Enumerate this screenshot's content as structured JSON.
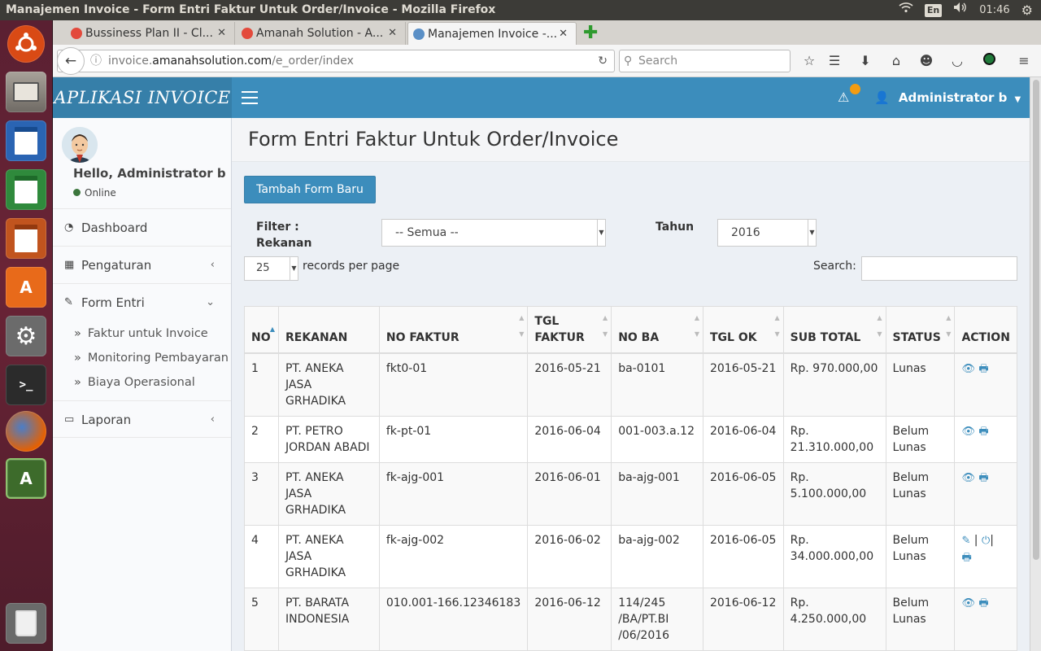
{
  "system": {
    "window_title": "Manajemen Invoice - Form Entri Faktur Untuk Order/Invoice - Mozilla Firefox",
    "lang": "En",
    "time": "01:46"
  },
  "browser": {
    "tabs": [
      {
        "label": "Bussiness Plan II - Cl..."
      },
      {
        "label": "Amanah Solution - A..."
      },
      {
        "label": "Manajemen Invoice -..."
      }
    ],
    "url_prefix": "invoice.",
    "url_domain": "amanahsolution.com",
    "url_path": "/e_order/index",
    "search_placeholder": "Search"
  },
  "app": {
    "logo": "APLIKASI INVOICE",
    "user": "Administrator b",
    "hello": "Hello, Administrator b",
    "status": "Online",
    "menu": {
      "dashboard": "Dashboard",
      "pengaturan": "Pengaturan",
      "form_entri": "Form Entri",
      "sub": [
        "Faktur untuk Invoice",
        "Monitoring Pembayaran",
        "Biaya Operasional"
      ],
      "laporan": "Laporan"
    }
  },
  "content": {
    "title": "Form Entri Faktur Untuk Order/Invoice",
    "add_button": "Tambah Form Baru",
    "filter_label_1": "Filter :",
    "filter_label_2": "Rekanan",
    "filter_value": "-- Semua --",
    "year_label": "Tahun",
    "year_value": "2016",
    "page_size": "25",
    "records_label": "records per page",
    "search_label": "Search:"
  },
  "table": {
    "headers": [
      "NO",
      "REKANAN",
      "NO FAKTUR",
      "TGL FAKTUR",
      "NO BA",
      "TGL OK",
      "SUB TOTAL",
      "STATUS",
      "ACTION"
    ],
    "rows": [
      {
        "no": "1",
        "rekanan": "PT. ANEKA JASA GRHADIKA",
        "faktur": "fkt0-01",
        "tgl_faktur": "2016-05-21",
        "no_ba": "ba-0101",
        "tgl_ok": "2016-05-21",
        "subtotal": "Rp. 970.000,00",
        "status": "Lunas"
      },
      {
        "no": "2",
        "rekanan": "PT. PETRO JORDAN ABADI",
        "faktur": "fk-pt-01",
        "tgl_faktur": "2016-06-04",
        "no_ba": "001-003.a.12",
        "tgl_ok": "2016-06-04",
        "subtotal": "Rp. 21.310.000,00",
        "status": "Belum Lunas"
      },
      {
        "no": "3",
        "rekanan": "PT. ANEKA JASA GRHADIKA",
        "faktur": "fk-ajg-001",
        "tgl_faktur": "2016-06-01",
        "no_ba": "ba-ajg-001",
        "tgl_ok": "2016-06-05",
        "subtotal": "Rp. 5.100.000,00",
        "status": "Belum Lunas"
      },
      {
        "no": "4",
        "rekanan": "PT. ANEKA JASA GRHADIKA",
        "faktur": "fk-ajg-002",
        "tgl_faktur": "2016-06-02",
        "no_ba": "ba-ajg-002",
        "tgl_ok": "2016-06-05",
        "subtotal": "Rp. 34.000.000,00",
        "status": "Belum Lunas"
      },
      {
        "no": "5",
        "rekanan": "PT. BARATA INDONESIA",
        "faktur": "010.001-166.12346183",
        "tgl_faktur": "2016-06-12",
        "no_ba": "114/245 /BA/PT.BI /06/2016",
        "tgl_ok": "2016-06-12",
        "subtotal": "Rp. 4.250.000,00",
        "status": "Belum Lunas"
      }
    ]
  },
  "colors": {
    "header": "#3c8dbc",
    "logo_bg": "#367fa9",
    "launcher": "#5a2032"
  }
}
